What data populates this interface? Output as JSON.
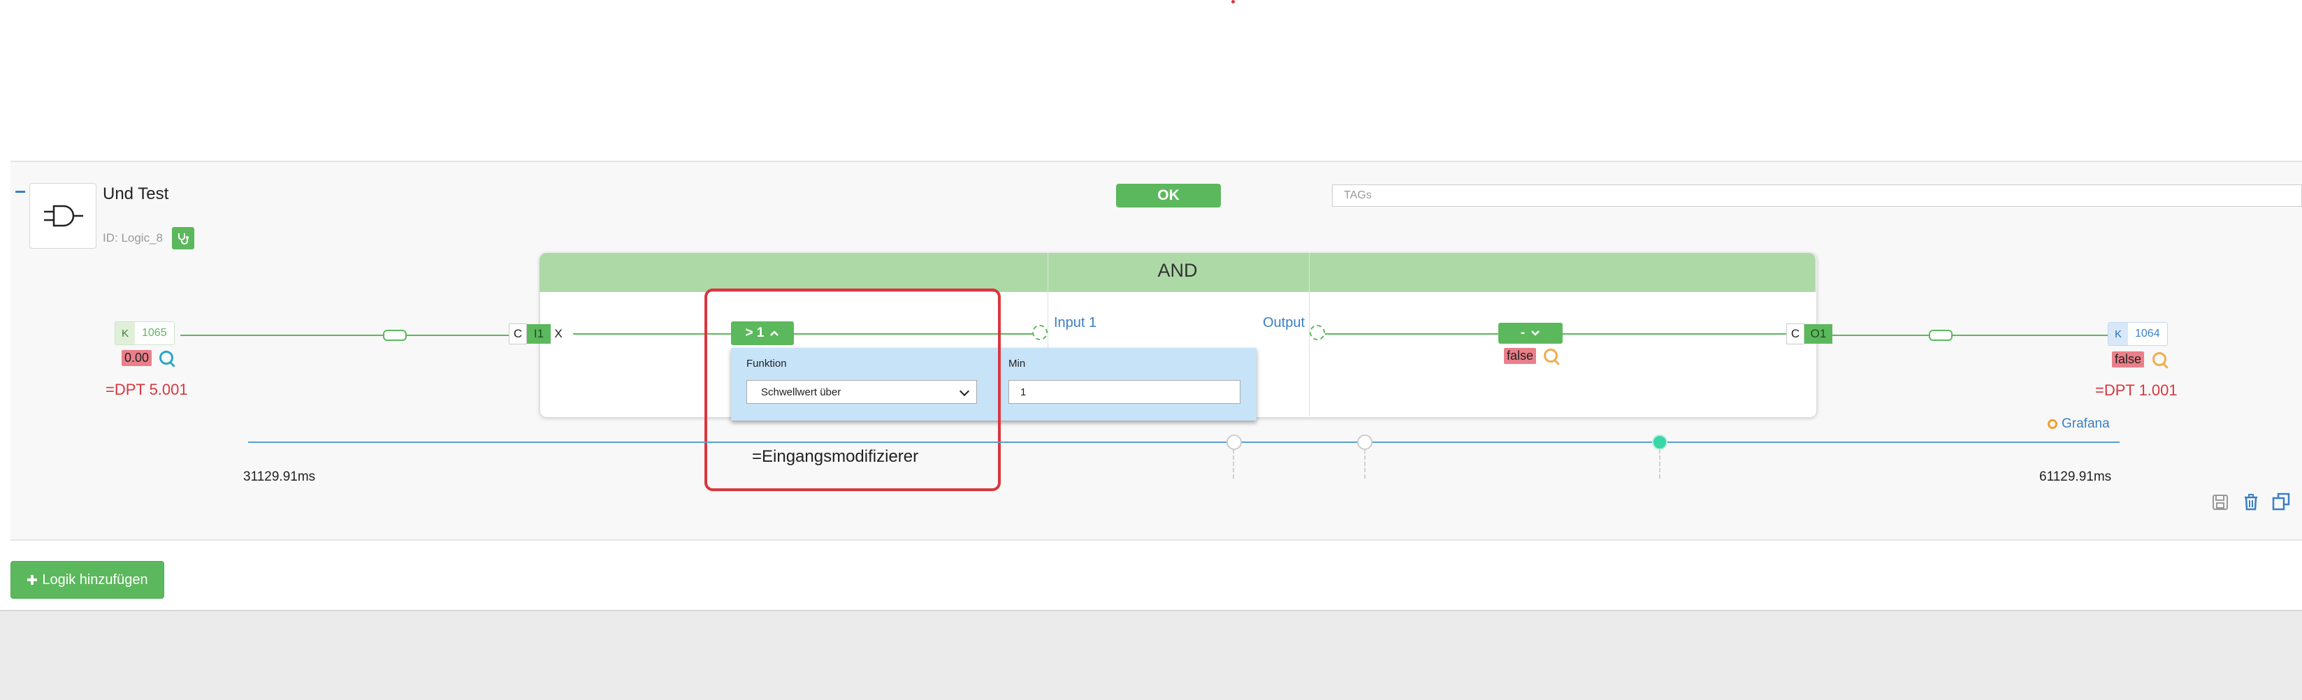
{
  "logic": {
    "title": "Und Test",
    "id_label": "ID: Logic_8",
    "status_button": "OK",
    "tags_placeholder": "TAGs"
  },
  "block": {
    "title": "AND",
    "input_label": "Input 1",
    "output_label": "Output"
  },
  "input_chip": {
    "k": "K",
    "address": "1065",
    "value": "0.00",
    "dpt": "=DPT 5.001"
  },
  "output_chip": {
    "k": "K",
    "address": "1064",
    "value": "false",
    "dpt": "=DPT 1.001"
  },
  "input_connector": {
    "c": "C",
    "io": "I1",
    "x": "X"
  },
  "output_connector": {
    "c": "C",
    "io": "O1"
  },
  "modifier": {
    "button_label": "> 1",
    "function_label": "Funktion",
    "function_value": "Schwellwert über",
    "min_label": "Min",
    "min_value": "1",
    "annotation": "=Eingangsmodifizierer"
  },
  "output_modifier": {
    "button_label": "-",
    "value": "false"
  },
  "timeline": {
    "start": "31129.91ms",
    "end": "61129.91ms",
    "grafana_label": "Grafana"
  },
  "footer": {
    "add_button": "Logik hinzufügen"
  },
  "colors": {
    "green": "#5cb85c",
    "header_green": "#add9a7",
    "highlight_red": "#d9363e",
    "popup_blue": "#c6e3f8",
    "link_blue": "#3a7fc4"
  },
  "icons": [
    "and-gate-icon",
    "stethoscope-icon",
    "magnifier-icon",
    "chevron-up-icon",
    "chevron-down-icon",
    "grafana-icon",
    "save-icon",
    "trash-icon",
    "copy-icon",
    "plus-icon"
  ]
}
